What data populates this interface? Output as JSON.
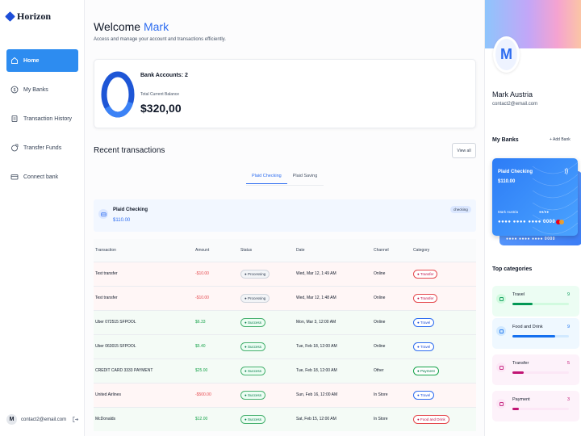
{
  "brand": {
    "name": "Horizon"
  },
  "sidebar": {
    "items": [
      {
        "label": "Home",
        "icon": "home-icon",
        "active": true
      },
      {
        "label": "My Banks",
        "icon": "dollar-circle-icon",
        "active": false
      },
      {
        "label": "Transaction History",
        "icon": "receipt-icon",
        "active": false
      },
      {
        "label": "Transfer Funds",
        "icon": "money-send-icon",
        "active": false
      },
      {
        "label": "Connect bank",
        "icon": "card-add-icon",
        "active": false
      }
    ],
    "footer": {
      "avatar_initial": "M",
      "email": "contact2@email.com"
    }
  },
  "header": {
    "greeting": "Welcome",
    "user_name": "Mark",
    "subtitle": "Access and manage your account and transactions efficiently."
  },
  "balance": {
    "accounts_label": "Bank Accounts: 2",
    "total_label": "Total Current Balance",
    "total_amount": "$320,00"
  },
  "recent": {
    "title": "Recent transactions",
    "view_all": "View all",
    "tabs": [
      {
        "label": "Plaid Checking",
        "active": true
      },
      {
        "label": "Plaid Saving",
        "active": false
      }
    ],
    "bank": {
      "name": "Plaid Checking",
      "amount": "$110.00",
      "badge": "checking"
    },
    "columns": [
      "Transaction",
      "Amount",
      "Status",
      "Date",
      "Channel",
      "Category"
    ],
    "rows": [
      {
        "name": "Test transfer",
        "amount": "-$10.00",
        "status": "Processing",
        "date": "Wed, Mar 12, 1:49 AM",
        "channel": "Online",
        "category": "Transfer"
      },
      {
        "name": "Test transfer",
        "amount": "-$10.00",
        "status": "Processing",
        "date": "Wed, Mar 12, 1:48 AM",
        "channel": "Online",
        "category": "Transfer"
      },
      {
        "name": "Uber 072515 SFPOOL",
        "amount": "$6.33",
        "status": "Success",
        "date": "Mon, Mar 3, 12:00 AM",
        "channel": "Online",
        "category": "Travel"
      },
      {
        "name": "Uber 063015 SFPOOL",
        "amount": "$5.40",
        "status": "Success",
        "date": "Tue, Feb 18, 12:00 AM",
        "channel": "Online",
        "category": "Travel"
      },
      {
        "name": "CREDIT CARD 3333 PAYMENT",
        "amount": "$25.00",
        "status": "Success",
        "date": "Tue, Feb 18, 12:00 AM",
        "channel": "Other",
        "category": "Payment"
      },
      {
        "name": "United Airlines",
        "amount": "-$500.00",
        "status": "Success",
        "date": "Sun, Feb 16, 12:00 AM",
        "channel": "In Store",
        "category": "Travel"
      },
      {
        "name": "McDonalds",
        "amount": "$12.00",
        "status": "Success",
        "date": "Sat, Feb 15, 12:00 AM",
        "channel": "In Store",
        "category": "Food and Drink"
      }
    ]
  },
  "profile": {
    "avatar_initial": "M",
    "name": "Mark Austria",
    "email": "contact2@email.com"
  },
  "my_banks": {
    "title": "My Banks",
    "add_label": "Add Bank",
    "card": {
      "bank_name": "Plaid Checking",
      "balance": "$110.00",
      "holder": "Mark Austria",
      "expiry": "●●/●●",
      "number": "●●●● ●●●● ●●●● 0000"
    },
    "back_card_number": "●●●● ●●●● ●●●● 0000"
  },
  "top_categories": {
    "title": "Top categories",
    "items": [
      {
        "name": "Travel",
        "count": "9",
        "fill": 0.35,
        "bg": "#ecfdf3",
        "bar_bg": "#d1fadf",
        "fill_color": "#039855",
        "text_color": "#039855"
      },
      {
        "name": "Food and Drink",
        "count": "9",
        "fill": 0.75,
        "bg": "#eff8ff",
        "bar_bg": "#d1e9ff",
        "fill_color": "#1570ef",
        "text_color": "#1570ef"
      },
      {
        "name": "Transfer",
        "count": "5",
        "fill": 0.2,
        "bg": "#fdf2fa",
        "bar_bg": "#fce7f6",
        "fill_color": "#c11574",
        "text_color": "#c11574"
      },
      {
        "name": "Payment",
        "count": "3",
        "fill": 0.12,
        "bg": "#fdf2fa",
        "bar_bg": "#fce7f6",
        "fill_color": "#c11574",
        "text_color": "#c11574"
      }
    ]
  },
  "colors": {
    "accent": "#2d8cf0",
    "brand": "#1d4ed8"
  }
}
